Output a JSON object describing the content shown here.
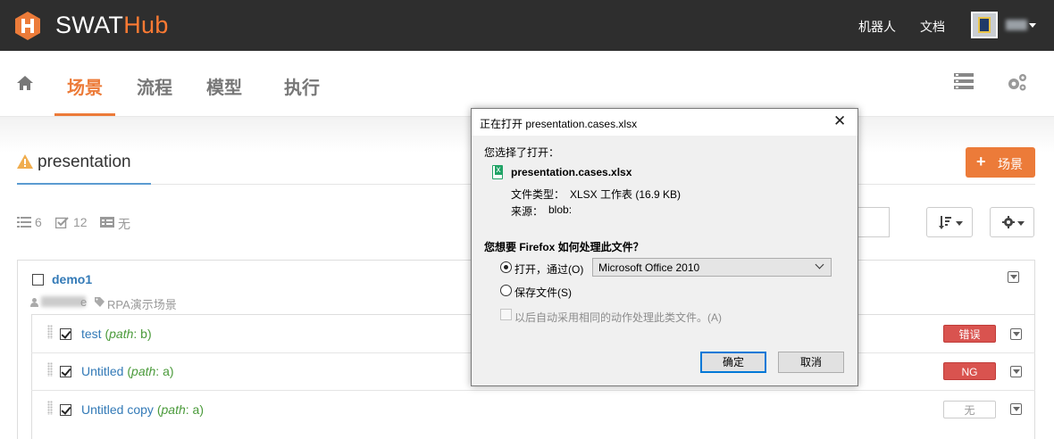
{
  "app": {
    "logo_main": "SWAT",
    "logo_accent": "Hub"
  },
  "topnav": {
    "robots": "机器人",
    "docs": "文档"
  },
  "tabs": [
    {
      "label": "场景",
      "active": true
    },
    {
      "label": "流程",
      "active": false
    },
    {
      "label": "模型",
      "active": false
    },
    {
      "label": "执行",
      "active": false
    }
  ],
  "scene": {
    "title": "presentation",
    "add_button": "场景",
    "stats": {
      "list_count": "6",
      "check_count": "12",
      "tag_label": "无"
    }
  },
  "group": {
    "name": "demo1",
    "owner_suffix": "e",
    "tag": "RPA演示场景",
    "cases": [
      {
        "name": "test",
        "path_key": "path",
        "path_val": "b",
        "status": "错误",
        "status_type": "red"
      },
      {
        "name": "Untitled",
        "path_key": "path",
        "path_val": "a",
        "status": "NG",
        "status_type": "red"
      },
      {
        "name": "Untitled copy",
        "path_key": "path",
        "path_val": "a",
        "status": "无",
        "status_type": "none"
      }
    ]
  },
  "dialog": {
    "title": "正在打开 presentation.cases.xlsx",
    "chosen_label": "您选择了打开：",
    "file_name": "presentation.cases.xlsx",
    "type_label": "文件类型：",
    "type_value": "XLSX 工作表 (16.9 KB)",
    "source_label": "来源：",
    "source_value": "blob:",
    "question": "您想要 Firefox 如何处理此文件？",
    "open_with_label": "打开，通过(O)",
    "open_with_app": "Microsoft Office 2010",
    "save_label": "保存文件(S)",
    "remember_label": "以后自动采用相同的动作处理此类文件。(A)",
    "ok": "确定",
    "cancel": "取消",
    "close_symbol": "✕"
  },
  "colors": {
    "accent": "#ec7b39",
    "topbar": "#2e2e2e",
    "link": "#337ab7",
    "error": "#d9534f"
  },
  "icons": [
    "home-icon",
    "warning-icon",
    "list-icon",
    "checklist-icon",
    "tag-list-icon",
    "user-icon",
    "tag-icon",
    "sort-icon",
    "gear-icon",
    "gears-icon",
    "close-icon",
    "excel-icon"
  ]
}
